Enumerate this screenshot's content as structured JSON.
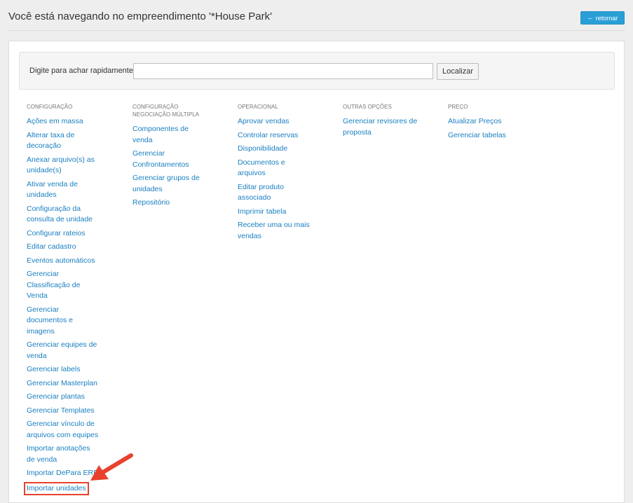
{
  "header": {
    "title": "Você está navegando no empreendimento '*House Park'",
    "back_label": "retornar"
  },
  "search": {
    "label": "Digite para achar rapidamente:",
    "value": "",
    "placeholder": "",
    "button_label": "Localizar"
  },
  "columns": {
    "configuracao": {
      "heading": "CONFIGURAÇÃO",
      "items": [
        "Ações em massa",
        "Alterar taxa de decoração",
        "Anexar arquivo(s) as unidade(s)",
        "Ativar venda de unidades",
        "Configuração da consulta de unidade",
        "Configurar rateios",
        "Editar cadastro",
        "Eventos automáticos",
        "Gerenciar Classificação de Venda",
        "Gerenciar documentos e imagens",
        "Gerenciar equipes de venda",
        "Gerenciar labels",
        "Gerenciar Masterplan",
        "Gerenciar plantas",
        "Gerenciar Templates",
        "Gerenciar vínculo de arquivos com equipes",
        "Importar anotações de venda",
        "Importar DePara ERP",
        "Importar unidades"
      ]
    },
    "negociacao": {
      "heading_line1": "CONFIGURAÇÃO",
      "heading_line2": "NEGOCIAÇÃO MÚLTIPLA",
      "items": [
        "Componentes de venda",
        "Gerenciar Confrontamentos",
        "Gerenciar grupos de unidades",
        "Repositório"
      ]
    },
    "operacional": {
      "heading": "OPERACIONAL",
      "items": [
        "Aprovar vendas",
        "Controlar reservas",
        "Disponibilidade",
        "Documentos e arquivos",
        "Editar produto associado",
        "Imprimir tabela",
        "Receber uma ou mais vendas"
      ]
    },
    "outras": {
      "heading": "OUTRAS OPÇÕES",
      "items": [
        "Gerenciar revisores de proposta"
      ]
    },
    "preco": {
      "heading": "PREÇO",
      "items": [
        "Atualizar Preços",
        "Gerenciar tabelas"
      ]
    }
  },
  "colors": {
    "link": "#1a7fc1",
    "accent_button": "#2a9fd6",
    "highlight": "#e8412c"
  },
  "icons": {
    "back": "arrow-left-icon",
    "pointer": "red-arrow-pointer-icon"
  }
}
